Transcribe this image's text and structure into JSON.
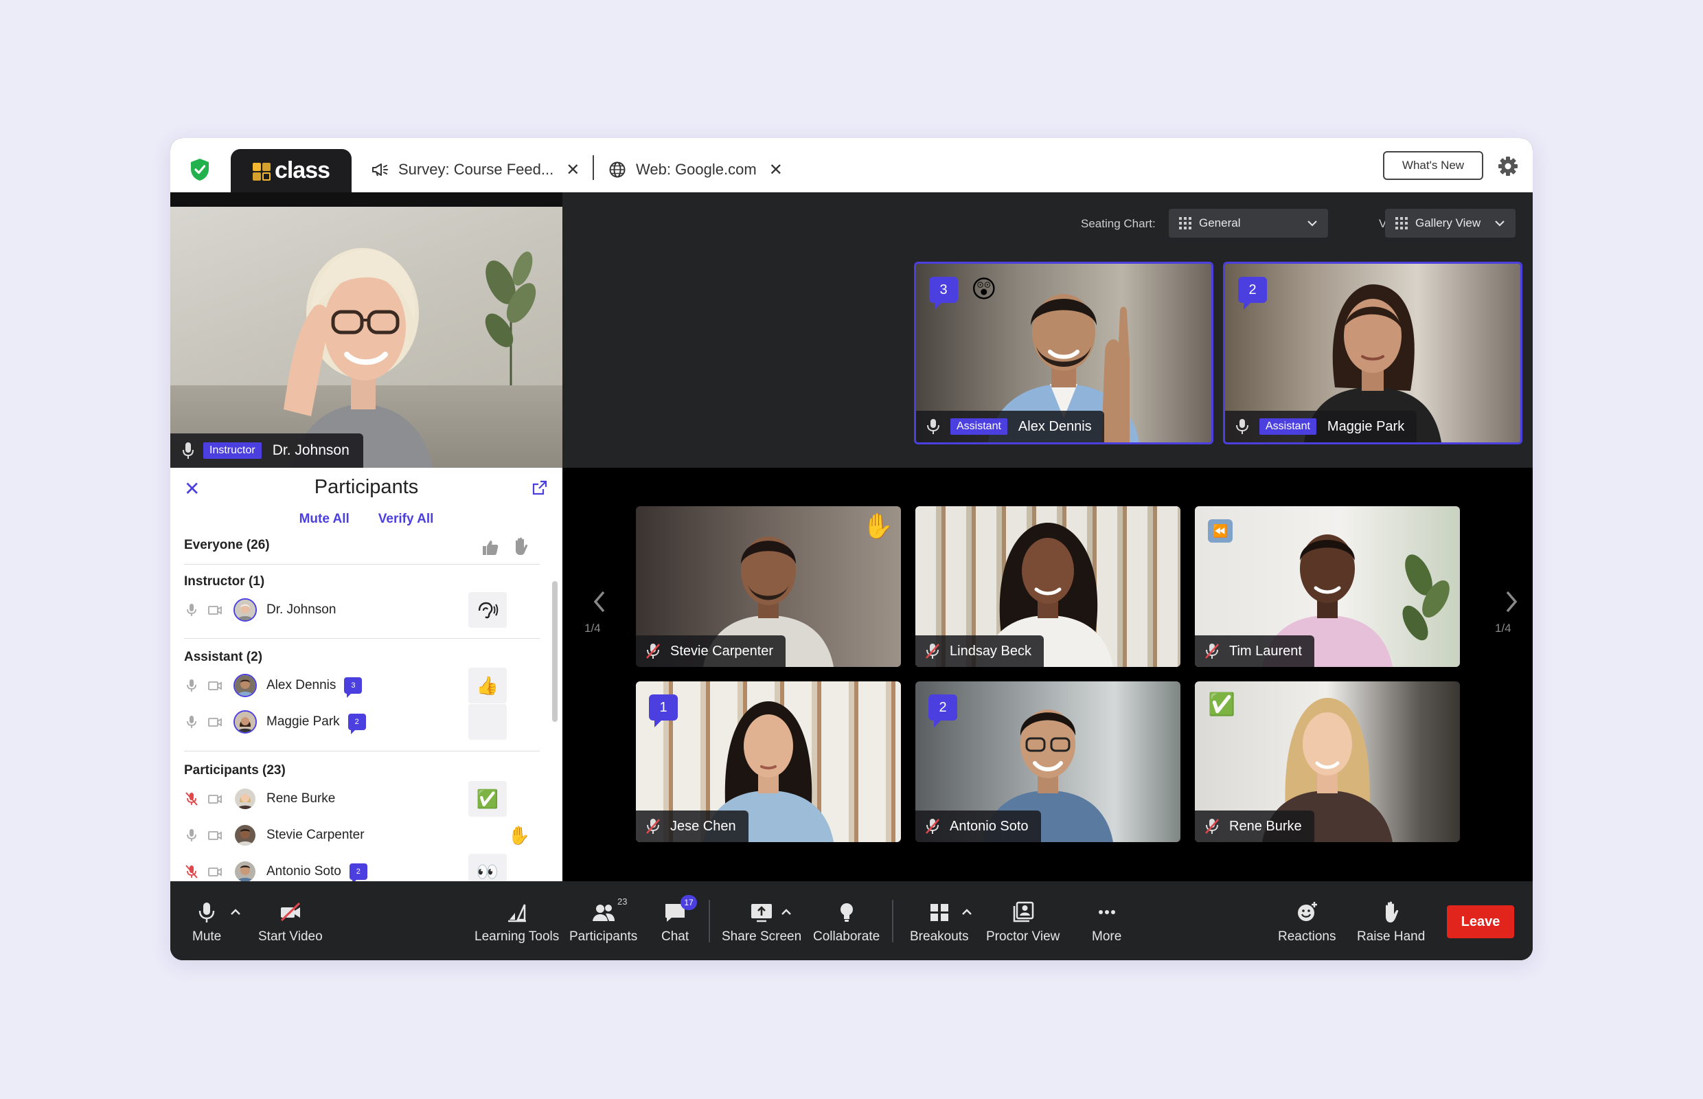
{
  "tabs": {
    "brand": "class",
    "survey": "Survey: Course Feed...",
    "web": "Web: Google.com"
  },
  "header": {
    "whats_new": "What's New"
  },
  "instructor": {
    "role": "Instructor",
    "name": "Dr. Johnson"
  },
  "controls": {
    "seating_label": "Seating Chart:",
    "seating_value": "General",
    "view_label": "View:",
    "view_value": "Gallery View"
  },
  "panel": {
    "title": "Participants",
    "mute_all": "Mute All",
    "verify_all": "Verify All",
    "everyone": "Everyone (26)",
    "instructor_section": "Instructor (1)",
    "assistant_section": "Assistant (2)",
    "participants_section": "Participants (23)",
    "rows": [
      {
        "name": "Dr. Johnson",
        "badge": "",
        "status": "speaking-icon",
        "muted": false
      },
      {
        "name": "Alex Dennis",
        "badge": "3",
        "status": "👍",
        "muted": false
      },
      {
        "name": "Maggie Park",
        "badge": "2",
        "status": "",
        "muted": false
      },
      {
        "name": "Rene Burke",
        "badge": "",
        "status": "✅",
        "muted": true
      },
      {
        "name": "Stevie Carpenter",
        "badge": "",
        "status": "✋",
        "muted": false
      },
      {
        "name": "Antonio Soto",
        "badge": "2",
        "status": "👀",
        "muted": true
      }
    ]
  },
  "featured": [
    {
      "role": "Assistant",
      "name": "Alex Dennis",
      "bubble": "3",
      "emoji": "😲"
    },
    {
      "role": "Assistant",
      "name": "Maggie Park",
      "bubble": "2",
      "emoji": ""
    }
  ],
  "gallery": [
    {
      "name": "Stevie Carpenter",
      "bubble": "",
      "emoji": "✋"
    },
    {
      "name": "Lindsay Beck",
      "bubble": "",
      "emoji": ""
    },
    {
      "name": "Tim Laurent",
      "bubble": "",
      "emoji": "⏪"
    },
    {
      "name": "Jese Chen",
      "bubble": "1",
      "emoji": ""
    },
    {
      "name": "Antonio Soto",
      "bubble": "2",
      "emoji": ""
    },
    {
      "name": "Rene Burke",
      "bubble": "",
      "emoji": "✅"
    }
  ],
  "pager": {
    "left": "1/4",
    "right": "1/4"
  },
  "toolbar": {
    "mute": "Mute",
    "start_video": "Start Video",
    "learning_tools": "Learning Tools",
    "participants": "Participants",
    "participants_count": "23",
    "chat": "Chat",
    "chat_count": "17",
    "share_screen": "Share Screen",
    "collaborate": "Collaborate",
    "breakouts": "Breakouts",
    "proctor_view": "Proctor View",
    "more": "More",
    "reactions": "Reactions",
    "raise_hand": "Raise Hand",
    "leave": "Leave"
  },
  "colors": {
    "accent": "#4b3fe0",
    "leave": "#e1241c",
    "brand_yellow": "#f4b731",
    "shield_green": "#22b14c"
  }
}
